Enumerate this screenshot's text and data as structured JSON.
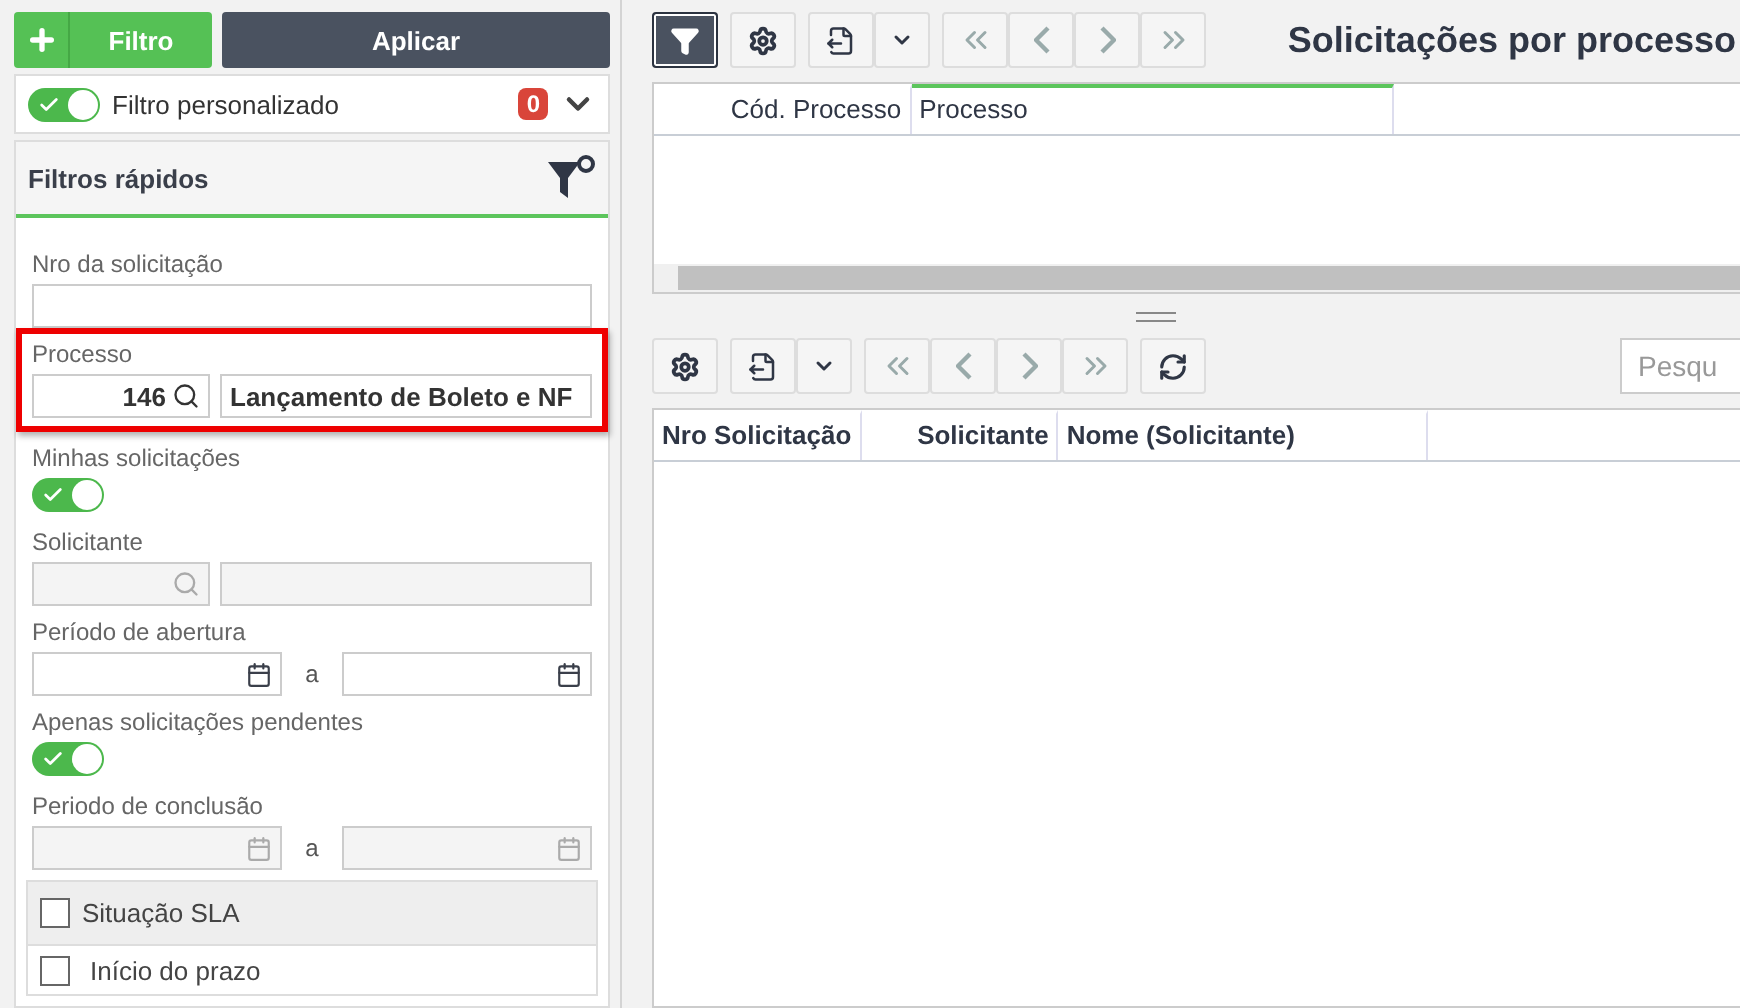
{
  "sidebar": {
    "add_filter_button": {
      "label": "Filtro"
    },
    "apply_button": "Aplicar",
    "custom_filter": {
      "label": "Filtro personalizado",
      "on": true,
      "count": "0"
    },
    "quick_filters": {
      "title": "Filtros rápidos",
      "fields": [
        {
          "kind": "text",
          "label": "Nro da solicitação",
          "highlighted": false
        },
        {
          "kind": "lookup",
          "label": "Processo",
          "code": "146",
          "name": "Lançamento de Boleto e NF",
          "disabled": false,
          "highlighted": true
        },
        {
          "kind": "toggle",
          "label": "Minhas solicitações",
          "on": true
        },
        {
          "kind": "lookup",
          "label": "Solicitante",
          "disabled": true,
          "highlighted": false
        },
        {
          "kind": "daterange",
          "label": "Período de abertura",
          "separator": "a",
          "disabled": false
        },
        {
          "kind": "toggle",
          "label": "Apenas solicitações pendentes",
          "on": true
        },
        {
          "kind": "daterange",
          "label": "Periodo de conclusão",
          "separator": "a",
          "disabled": true
        }
      ],
      "sla": {
        "header": {
          "label": "Situação SLA",
          "checked": false
        },
        "items": [
          {
            "label": "Início do prazo",
            "checked": false
          }
        ]
      }
    }
  },
  "main": {
    "title": "Solicitações por processo",
    "filter_active": true,
    "process_grid": {
      "columns": [
        {
          "label": "Cód. Processo",
          "sorted": false
        },
        {
          "label": "Processo",
          "sorted": true
        }
      ]
    },
    "requests_toolbar": {
      "search": {
        "placeholder": "Pesqu"
      }
    },
    "requests_grid": {
      "columns": [
        {
          "label": "Nro Solicitação",
          "sorted": false
        },
        {
          "label": "Solicitante",
          "sorted": false
        },
        {
          "label": "Nome (Solicitante)",
          "sorted": false
        }
      ]
    }
  }
}
